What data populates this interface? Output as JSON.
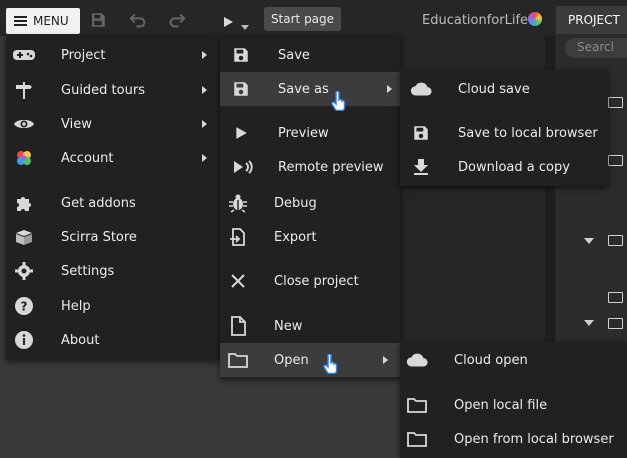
{
  "topbar": {
    "menu_label": "MENU",
    "start_page_label": "Start page",
    "brand": "EducationforLife",
    "project_tab": "PROJECT",
    "search_placeholder": "Searcl"
  },
  "main_menu": {
    "items": [
      {
        "label": "Project",
        "icon": "gamepad-icon",
        "submenu": true
      },
      {
        "label": "Guided tours",
        "icon": "signpost-icon",
        "submenu": true
      },
      {
        "label": "View",
        "icon": "eye-icon",
        "submenu": true
      },
      {
        "label": "Account",
        "icon": "account-logo-icon",
        "submenu": true
      },
      {
        "label": "Get addons",
        "icon": "puzzle-icon",
        "submenu": false
      },
      {
        "label": "Scirra Store",
        "icon": "store-box-icon",
        "submenu": false
      },
      {
        "label": "Settings",
        "icon": "gear-icon",
        "submenu": false
      },
      {
        "label": "Help",
        "icon": "help-icon",
        "submenu": false
      },
      {
        "label": "About",
        "icon": "info-icon",
        "submenu": false
      }
    ]
  },
  "project_menu": {
    "items": [
      {
        "label": "Save",
        "icon": "save-icon"
      },
      {
        "label": "Save as",
        "icon": "save-as-icon",
        "submenu": true
      },
      {
        "label": "Preview",
        "icon": "play-icon"
      },
      {
        "label": "Remote preview",
        "icon": "remote-preview-icon"
      },
      {
        "label": "Debug",
        "icon": "bug-icon"
      },
      {
        "label": "Export",
        "icon": "export-icon"
      },
      {
        "label": "Close project",
        "icon": "close-icon"
      },
      {
        "label": "New",
        "icon": "new-file-icon"
      },
      {
        "label": "Open",
        "icon": "folder-icon",
        "submenu": true
      }
    ]
  },
  "save_as_menu": {
    "items": [
      {
        "label": "Cloud save",
        "icon": "cloud-icon"
      },
      {
        "label": "Save to local browser",
        "icon": "save-icon"
      },
      {
        "label": "Download a copy",
        "icon": "download-icon"
      }
    ]
  },
  "open_menu": {
    "items": [
      {
        "label": "Cloud open",
        "icon": "cloud-icon"
      },
      {
        "label": "Open local file",
        "icon": "folder-icon"
      },
      {
        "label": "Open from local browser",
        "icon": "folder-icon"
      }
    ]
  },
  "colors": {
    "menu_bg": "#212121",
    "highlight_bg": "#3c3c3c",
    "cursor_blue": "#2f7fe0",
    "text": "#ececec"
  }
}
